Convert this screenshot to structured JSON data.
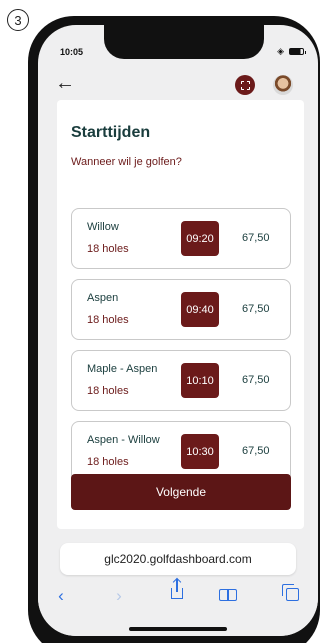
{
  "step": "3",
  "status_bar": {
    "time": "10:05"
  },
  "page": {
    "title": "Starttijden",
    "subtitle": "Wanneer wil je golfen?"
  },
  "slots": [
    {
      "course": "Willow",
      "holes": "18 holes",
      "time": "09:20",
      "price": "67,50"
    },
    {
      "course": "Aspen",
      "holes": "18 holes",
      "time": "09:40",
      "price": "67,50"
    },
    {
      "course": "Maple - Aspen",
      "holes": "18 holes",
      "time": "10:10",
      "price": "67,50"
    },
    {
      "course": "Aspen - Willow",
      "holes": "18 holes",
      "time": "10:30",
      "price": "67,50"
    }
  ],
  "next_button": "Volgende",
  "browser": {
    "url": "glc2020.golfdashboard.com"
  },
  "colors": {
    "accent": "#6b1a1a",
    "button": "#5c1616",
    "heading": "#1a3d3d",
    "browser_blue": "#2d6fe0"
  },
  "icons": [
    "back-arrow-icon",
    "qr-scan-icon",
    "avatar",
    "wifi-icon",
    "battery-icon",
    "browser-back-icon",
    "browser-forward-icon",
    "share-icon",
    "bookmarks-icon",
    "tabs-icon"
  ]
}
